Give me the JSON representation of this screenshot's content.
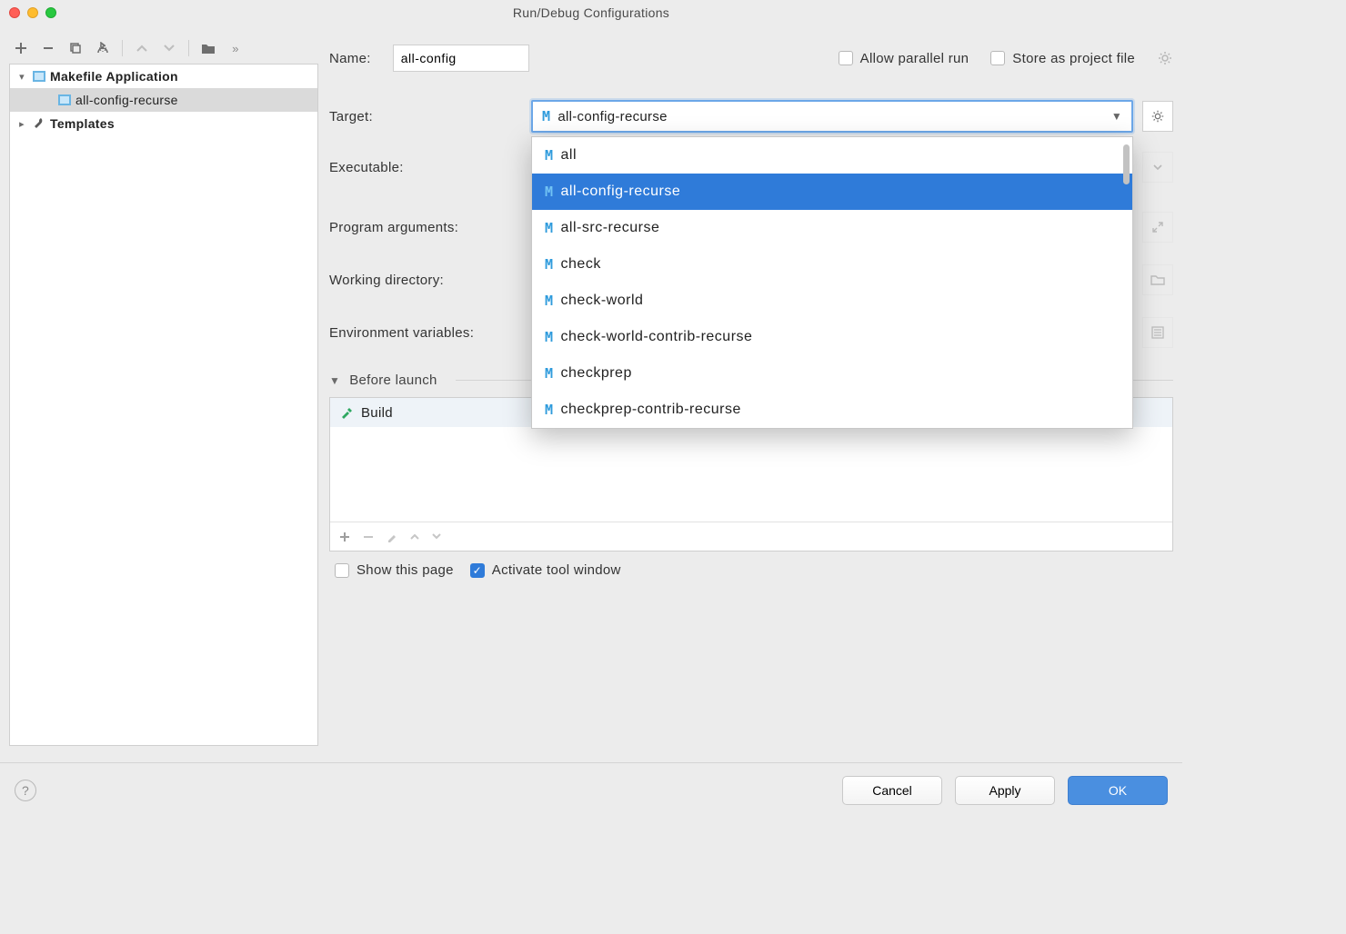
{
  "window": {
    "title": "Run/Debug Configurations"
  },
  "tree": {
    "root_label": "Makefile Application",
    "selected_child": "all-config-recurse",
    "templates_label": "Templates"
  },
  "form": {
    "name_label": "Name:",
    "name_value": "all-config",
    "allow_parallel_label": "Allow parallel run",
    "allow_parallel_checked": false,
    "store_project_file_label": "Store as project file",
    "store_project_file_checked": false,
    "target_label": "Target:",
    "target_value": "all-config-recurse",
    "target_options": [
      "all",
      "all-config-recurse",
      "all-src-recurse",
      "check",
      "check-world",
      "check-world-contrib-recurse",
      "checkprep",
      "checkprep-contrib-recurse"
    ],
    "target_selected_index": 1,
    "executable_label": "Executable:",
    "program_args_label": "Program arguments:",
    "working_dir_label": "Working directory:",
    "env_vars_label": "Environment variables:"
  },
  "before_launch": {
    "heading": "Before launch",
    "items": [
      "Build"
    ]
  },
  "bottom": {
    "show_page_label": "Show this page",
    "show_page_checked": false,
    "activate_tool_window_label": "Activate tool window",
    "activate_tool_window_checked": true
  },
  "footer": {
    "cancel": "Cancel",
    "apply": "Apply",
    "ok": "OK"
  }
}
